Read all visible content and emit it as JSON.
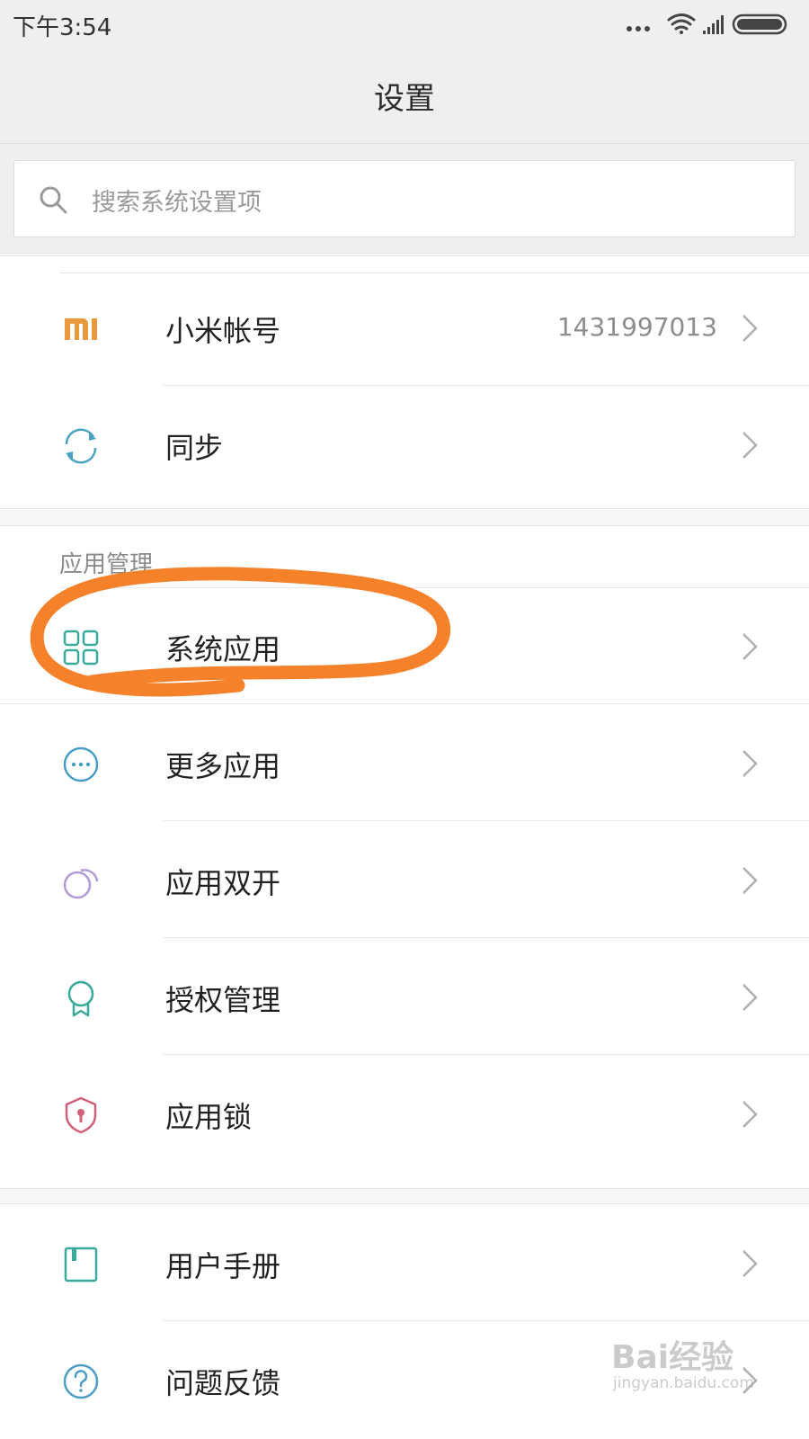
{
  "status_bar": {
    "time": "下午3:54",
    "icons": [
      "more-dots-icon",
      "wifi-icon",
      "signal-icon",
      "battery-icon"
    ]
  },
  "header": {
    "title": "设置"
  },
  "search": {
    "placeholder": "搜索系统设置项",
    "icon": "search-icon"
  },
  "account_section": {
    "items": [
      {
        "label": "小米帐号",
        "value": "1431997013",
        "icon": "mi-logo-icon",
        "icon_color": "#e89a3c"
      },
      {
        "label": "同步",
        "icon": "sync-icon",
        "icon_color": "#4aa3c2"
      }
    ]
  },
  "app_section": {
    "header": "应用管理",
    "items": [
      {
        "label": "系统应用",
        "icon": "grid-apps-icon",
        "icon_color": "#3aaa9a"
      },
      {
        "label": "更多应用",
        "icon": "more-circle-icon",
        "icon_color": "#4a9ec5"
      },
      {
        "label": "应用双开",
        "icon": "dual-app-icon",
        "icon_color": "#b39bd6"
      },
      {
        "label": "授权管理",
        "icon": "ribbon-icon",
        "icon_color": "#3aaa9a"
      },
      {
        "label": "应用锁",
        "icon": "shield-lock-icon",
        "icon_color": "#d0607a"
      }
    ]
  },
  "help_section": {
    "items": [
      {
        "label": "用户手册",
        "icon": "manual-book-icon",
        "icon_color": "#3aaa9a"
      },
      {
        "label": "问题反馈",
        "icon": "feedback-question-icon",
        "icon_color": "#4a9ec5"
      }
    ]
  },
  "annotation": {
    "color": "#f47b20",
    "target": "系统应用"
  },
  "watermark": {
    "main": "Bai经验",
    "sub": "jingyan.baidu.com"
  }
}
